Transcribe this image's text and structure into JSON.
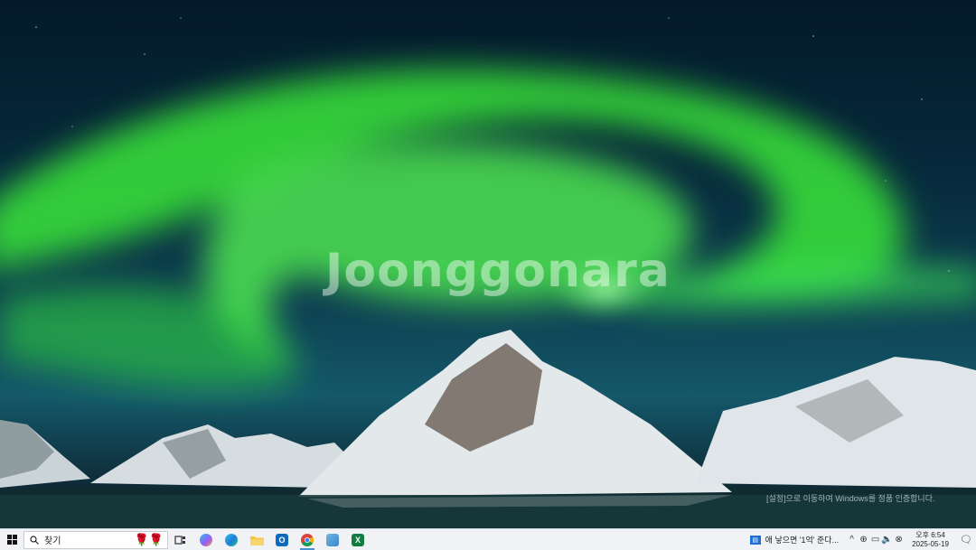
{
  "desktop": {
    "watermark": "Joonggonara",
    "activation_text": "[설정]으로 이동하여 Windows를 정품 인증합니다."
  },
  "taskbar": {
    "search": {
      "label": "찾기",
      "icon": "search-icon"
    },
    "apps": [
      {
        "name": "task-view",
        "icon": "task-view-icon"
      },
      {
        "name": "copilot",
        "icon": "copilot-icon"
      },
      {
        "name": "edge",
        "icon": "edge-icon"
      },
      {
        "name": "file-explorer",
        "icon": "folder-icon"
      },
      {
        "name": "outlook",
        "icon": "outlook-icon",
        "glyph": "O"
      },
      {
        "name": "chrome",
        "icon": "chrome-icon",
        "active": true
      },
      {
        "name": "notepad",
        "icon": "notepad-icon"
      },
      {
        "name": "excel",
        "icon": "excel-icon",
        "glyph": "X"
      }
    ],
    "news": "애 낳으면 '1억' 준다...",
    "clock": {
      "time": "오후 6:54",
      "date": "2025-05-19"
    },
    "colors": {
      "taskbar_bg": "#f0f2f5",
      "active_indicator": "#4a90d9"
    }
  }
}
